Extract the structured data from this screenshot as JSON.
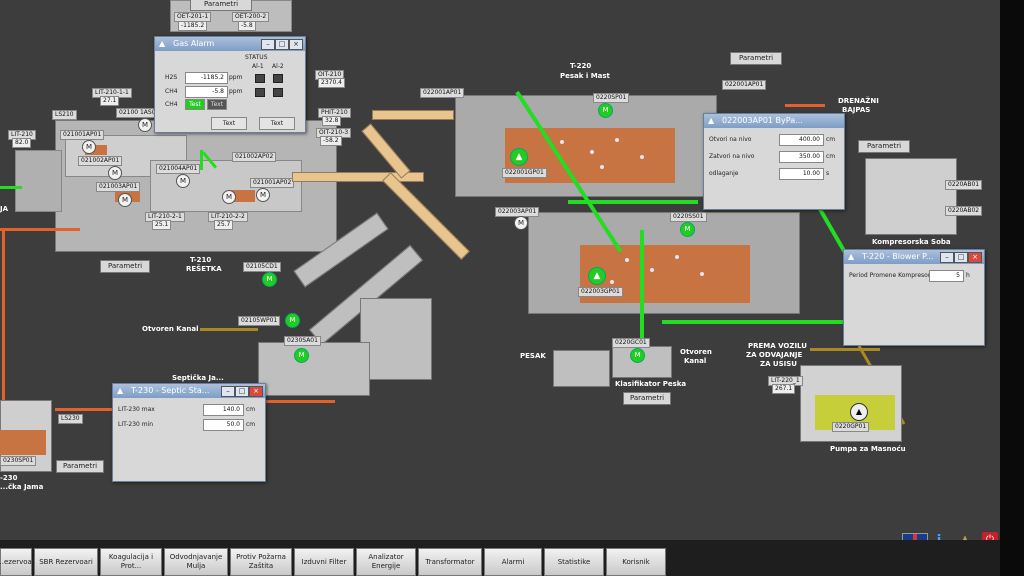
{
  "main_tanks": {
    "t220": {
      "name": "T-220",
      "subtitle": "Pesak i Mast"
    },
    "t210": {
      "name": "T-210",
      "subtitle": "REŠETKA"
    },
    "t230": {
      "name": "T-230",
      "subtitle": "Septička Jama"
    }
  },
  "gas_alarm": {
    "title": "Gas Alarm",
    "status_label": "STATUS",
    "col_al1": "Al-1",
    "col_al2": "Al-2",
    "rows": [
      {
        "gas": "H2S",
        "value": "-1185.2",
        "unit": "ppm"
      },
      {
        "gas": "CH4",
        "value": "-5.8",
        "unit": "ppm"
      },
      {
        "gas": "CH4",
        "value": "",
        "unit": ""
      }
    ],
    "btn_test1": "Test",
    "btn_test2": "Text",
    "btn_a": "Text",
    "btn_b": "Text"
  },
  "bypass_window": {
    "title": "022003AP01 ByPa...",
    "fields": [
      {
        "label": "Otvori na nivo",
        "value": "400.00",
        "unit": "cm"
      },
      {
        "label": "Zatvori na nivo",
        "value": "350.00",
        "unit": "cm"
      },
      {
        "label": "odlaganje",
        "value": "10.00",
        "unit": "s"
      }
    ]
  },
  "blower_window": {
    "title": "T-220 - Blower P...",
    "field_label": "Period Promene Kompresora",
    "field_value": "5",
    "field_unit": "h"
  },
  "septic_window": {
    "title": "T-230 - Septic Sta...",
    "fields": [
      {
        "label": "LIT-230 max",
        "value": "140.0",
        "unit": "cm"
      },
      {
        "label": "LIT-230 min",
        "value": "50.0",
        "unit": "cm"
      }
    ]
  },
  "labels": {
    "parametri": "Parametri",
    "drenazni": "DRENAŽNI",
    "bajpas": "BAJPAS",
    "kompresorska": "Kompresorska Soba",
    "otvoren_kanal": "Otvoren Kanal",
    "otvoren": "Otvoren",
    "kanal": "Kanal",
    "pesak": "PESAK",
    "klasifikator": "Klasifikator Peska",
    "prema1": "PREMA VOZILU",
    "prema2": "ZA ODVAJANJE",
    "prema3": "ZA USISU",
    "pumpa": "Pumpa za Masnoću",
    "septicka": "Septička Ja...",
    "jama_left": "JA",
    "jama_bottom": "...čka Jama",
    "t230_left": "-230"
  },
  "tags": {
    "oet201": "OET-201-1",
    "oet201v": "-1185.2",
    "oet202": "OET-200-2",
    "oet202v": "-5.8",
    "oit210": "OIT-210",
    "oit210v": "2370.4",
    "lit2101": "LIT-210-1-1",
    "lit2101v": "27.1",
    "ls210": "LS210",
    "lit210a": "LIT-210",
    "lit210av": "82.0",
    "ap0210_1": "02100 1AS0",
    "ap021001": "021001AP01",
    "ap021002": "021002AP01",
    "ap021003": "021003AP01",
    "ap021004": "021004AP01",
    "ap021002b": "021002AP02",
    "ap021001b": "021001AP02",
    "lit2102": "LIT-210-2-1",
    "lit2102v": "25.1",
    "lit2103": "LIT-210-2-2",
    "lit2103v": "25.7",
    "phit": "PHIT-210",
    "phitv": "32.8",
    "oit2103": "OIT-210-3",
    "oit2103v": "-58.2",
    "cd021": "02105CD1",
    "wp021": "02105WP01",
    "sa0230": "0230SA01",
    "ls230": "LS230",
    "ap022001": "022001AP01",
    "sp0220": "0220SP01",
    "gp022001": "022001GP01",
    "ap022003": "022003AP01",
    "gp022003": "022003GP01",
    "ss022": "0220SS01",
    "gc0220": "0220GC01",
    "ap022001b": "022001AP01",
    "ap0220_1": "0220AB01",
    "ap0220_2": "0220AB02",
    "lit220": "LIT-220_1",
    "lit220v": "267.1",
    "gp0220": "0220GP01",
    "ip0230": "0230SP01"
  },
  "nav": [
    {
      "label": "...ezervoar"
    },
    {
      "label": "SBR Rezervoari"
    },
    {
      "label": "Koagulacija i Prot..."
    },
    {
      "label": "Odvodnjavanje Mulja"
    },
    {
      "label": "Protiv Požarna Zaštita"
    },
    {
      "label": "Izduvni Filter"
    },
    {
      "label": "Analizator Energije"
    },
    {
      "label": "Transformator"
    },
    {
      "label": "Alarmi"
    },
    {
      "label": "Statistike"
    },
    {
      "label": "Korisnik"
    }
  ],
  "top_param": "Parametri"
}
